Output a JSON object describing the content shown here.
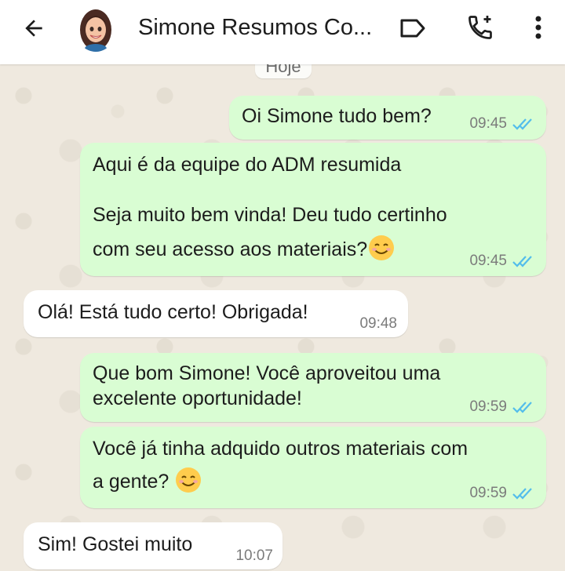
{
  "header": {
    "title": "Simone Resumos Co...",
    "back_icon": "arrow-left-icon",
    "label_icon": "label-icon",
    "call_icon": "add-call-icon",
    "more_icon": "more-vert-icon"
  },
  "date_chip": "Hoje",
  "messages": [
    {
      "direction": "out",
      "lines": [
        "Oi Simone tudo bem?"
      ],
      "time": "09:45",
      "status": "read"
    },
    {
      "direction": "out",
      "lines": [
        "Aqui é da equipe do ADM resumida",
        "",
        "Seja muito bem vinda! Deu tudo certinho",
        "com seu acesso aos materiais?"
      ],
      "emoji": "smiling-face",
      "time": "09:45",
      "status": "read"
    },
    {
      "direction": "in",
      "lines": [
        "Olá! Está tudo certo! Obrigada!"
      ],
      "time": "09:48"
    },
    {
      "direction": "out",
      "lines": [
        "Que bom Simone! Você aproveitou uma",
        "excelente oportunidade!"
      ],
      "time": "09:59",
      "status": "read"
    },
    {
      "direction": "out",
      "lines": [
        "Você já tinha adquido outros materiais com",
        "a gente?"
      ],
      "emoji": "smiling-face",
      "time": "09:59",
      "status": "read"
    },
    {
      "direction": "in",
      "lines": [
        "Sim! Gostei muito"
      ],
      "time": "10:07"
    }
  ],
  "colors": {
    "outgoing_bubble": "#d9fdd3",
    "incoming_bubble": "#ffffff",
    "read_ticks": "#53bdeb",
    "background": "#efe9df"
  }
}
